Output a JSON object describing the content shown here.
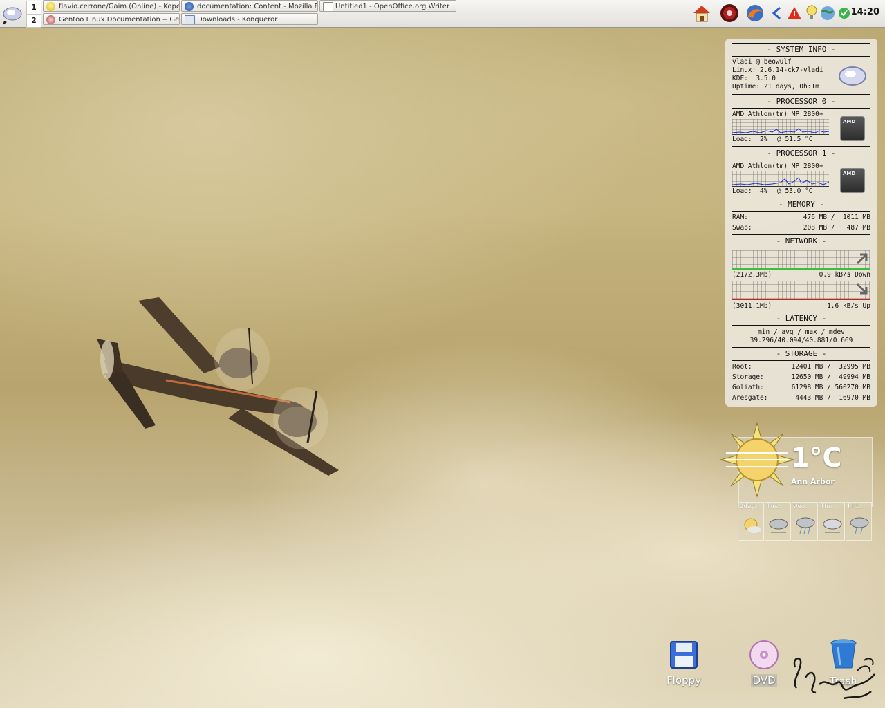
{
  "panel": {
    "desktops": [
      "1",
      "2"
    ],
    "tasks": [
      {
        "label": "flavio.cerrone/Gaim (Online) - Kope",
        "icon": "kopete-icon"
      },
      {
        "label": "documentation: Content - Mozilla Fi",
        "icon": "firefox-icon"
      },
      {
        "label": "Untitled1 - OpenOffice.org Writer",
        "icon": "writer-icon"
      },
      {
        "label": "Gentoo Linux Documentation -- Ge",
        "icon": "gentoo-icon"
      },
      {
        "label": "Downloads - Konqueror",
        "icon": "folder-icon"
      }
    ],
    "clock": "14:20"
  },
  "sysmon": {
    "system": {
      "title": "- SYSTEM INFO -",
      "user": "vladi @ beowulf",
      "linux": "Linux: 2.6.14-ck7-vladi",
      "kde": "KDE:  3.5.0",
      "uptime": "Uptime: 21 days, 0h:1m"
    },
    "cpu0": {
      "title": "- PROCESSOR 0 -",
      "model": "AMD Athlon(tm) MP 2800+",
      "load": "Load:  2%",
      "temp": "@ 51.5 °C"
    },
    "cpu1": {
      "title": "- PROCESSOR 1 -",
      "model": "AMD Athlon(tm) MP 2800+",
      "load": "Load:  4%",
      "temp": "@ 53.0 °C"
    },
    "chip_label": "AMD",
    "memory": {
      "title": "- MEMORY -",
      "ram_label": "RAM:",
      "ram_value": "476 MB /  1011 MB",
      "swap_label": "Swap:",
      "swap_value": "208 MB /   487 MB"
    },
    "network": {
      "title": "- NETWORK -",
      "down_total": "(2172.3Mb)",
      "down_rate": "0.9 kB/s Down",
      "up_total": "(3011.1Mb)",
      "up_rate": "1.6 kB/s Up"
    },
    "latency": {
      "title": "- LATENCY -",
      "header": "min / avg / max / mdev",
      "values": "39.296/40.094/40.881/0.669"
    },
    "storage": {
      "title": "- STORAGE -",
      "rows": [
        {
          "name": "Root:",
          "value": "12401 MB /  32995 MB"
        },
        {
          "name": "Storage:",
          "value": "12650 MB /  49994 MB"
        },
        {
          "name": "Goliath:",
          "value": "61298 MB / 560270 MB"
        },
        {
          "name": "Aresgate:",
          "value": "4443 MB /  16970 MB"
        }
      ]
    }
  },
  "weather": {
    "temp": "1°C",
    "city": "Ann Arbor",
    "forecast": [
      {
        "day": "2day:",
        "icon": "sunny-cloudy-icon"
      },
      {
        "day": "Tue:",
        "icon": "cloudy-icon"
      },
      {
        "day": "Wed:",
        "icon": "rain-icon"
      },
      {
        "day": "Thu:",
        "icon": "cloudy-icon"
      },
      {
        "day": "Fri:",
        "icon": "rain-icon"
      }
    ]
  },
  "desktop_icons": {
    "floppy": "Floppy",
    "dvd": "DVD",
    "trash": "Trash"
  }
}
